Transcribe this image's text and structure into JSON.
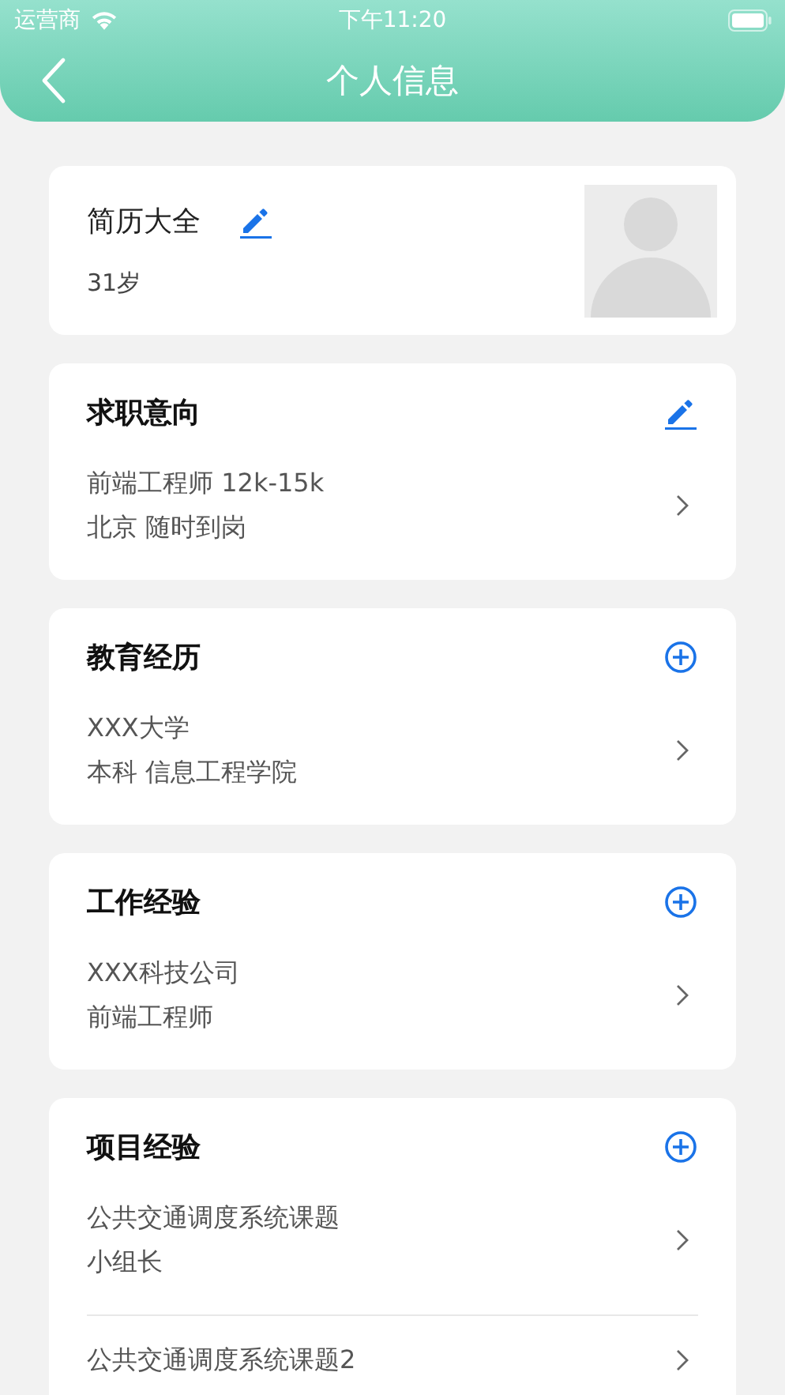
{
  "status_bar": {
    "carrier": "运营商",
    "time": "下午11:20"
  },
  "nav": {
    "title": "个人信息"
  },
  "profile": {
    "name": "简历大全",
    "age": "31岁"
  },
  "sections": [
    {
      "title": "求职意向",
      "kind": "edit",
      "entries": [
        {
          "lines": [
            "前端工程师 12k-15k",
            "北京 随时到岗"
          ]
        }
      ]
    },
    {
      "title": "教育经历",
      "kind": "add",
      "entries": [
        {
          "lines": [
            "XXX大学",
            "本科 信息工程学院"
          ]
        }
      ]
    },
    {
      "title": "工作经验",
      "kind": "add",
      "entries": [
        {
          "lines": [
            "XXX科技公司",
            "前端工程师"
          ]
        }
      ]
    },
    {
      "title": "项目经验",
      "kind": "add",
      "entries": [
        {
          "lines": [
            "公共交通调度系统课题",
            "小组长"
          ]
        },
        {
          "lines": [
            "公共交通调度系统课题2"
          ]
        }
      ]
    }
  ]
}
